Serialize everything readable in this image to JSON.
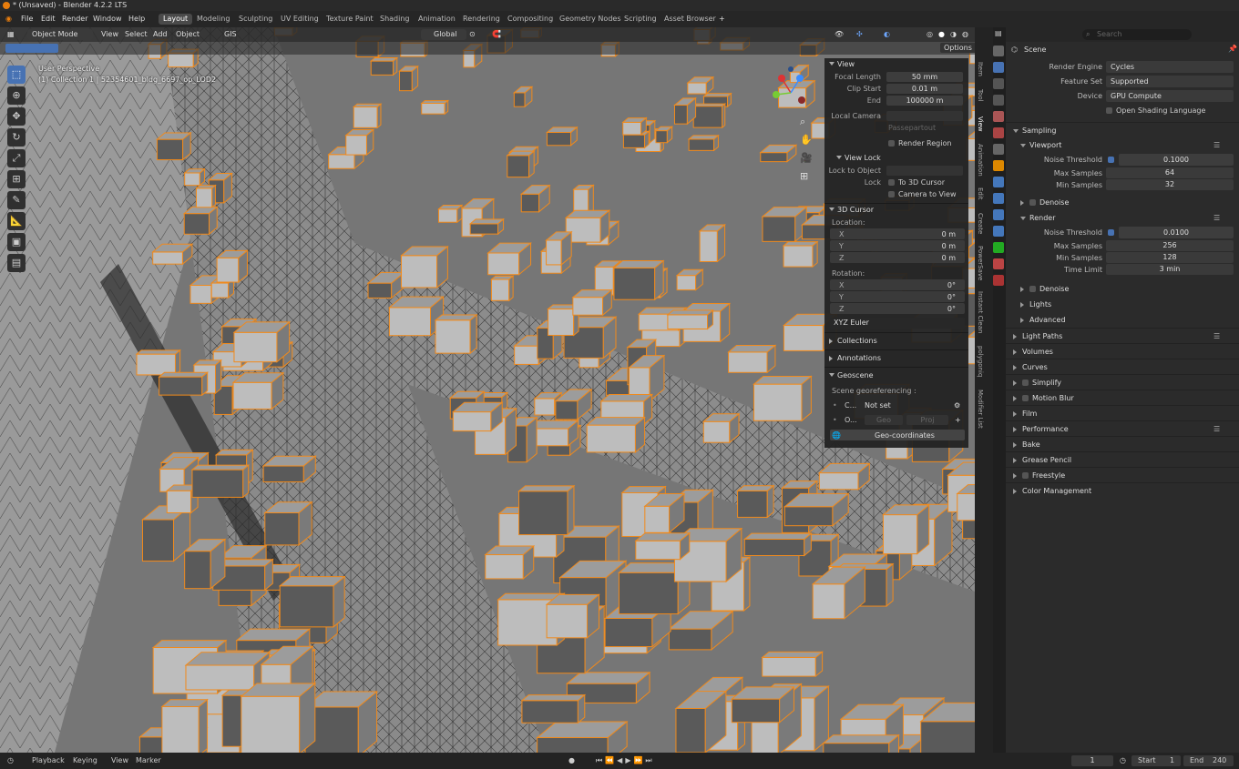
{
  "window": {
    "title": "* (Unsaved) - Blender 4.2.2 LTS"
  },
  "menu": {
    "file": "File",
    "edit": "Edit",
    "render": "Render",
    "window": "Window",
    "help": "Help"
  },
  "workspaces": [
    "Layout",
    "Modeling",
    "Sculpting",
    "UV Editing",
    "Texture Paint",
    "Shading",
    "Animation",
    "Rendering",
    "Compositing",
    "Geometry Nodes",
    "Scripting",
    "Asset Browser"
  ],
  "viewport": {
    "mode": "Object Mode",
    "menus": {
      "view": "View",
      "select": "Select",
      "add": "Add",
      "object": "Object",
      "gis": "GIS"
    },
    "orientation": "Global",
    "options": "Options",
    "info_line1": "User Perspective",
    "info_line2": "(1) Collection 1 | 52354601_bldg_6697_op_LOD2"
  },
  "npanel": {
    "view_header": "View",
    "focal_length_label": "Focal Length",
    "focal_length": "50 mm",
    "clip_start_label": "Clip Start",
    "clip_start": "0.01 m",
    "end_label": "End",
    "end": "100000 m",
    "local_camera_label": "Local Camera",
    "passepartout": "Passepartout",
    "render_region": "Render Region",
    "view_lock_header": "View Lock",
    "lock_to_object_label": "Lock to Object",
    "lock_label": "Lock",
    "to_3d_cursor": "To 3D Cursor",
    "camera_to_view": "Camera to View",
    "cursor_header": "3D Cursor",
    "location_label": "Location:",
    "rotation_label": "Rotation:",
    "x": "X",
    "y": "Y",
    "z": "Z",
    "loc_x": "0 m",
    "loc_y": "0 m",
    "loc_z": "0 m",
    "rot_x": "0°",
    "rot_y": "0°",
    "rot_z": "0°",
    "rotation_mode": "XYZ Euler",
    "collections": "Collections",
    "annotations": "Annotations",
    "geoscene": "Geoscene",
    "georef_label": "Scene georeferencing :",
    "crs_short": "C...",
    "crs_value": "Not set",
    "origin_short": "O...",
    "geo_btn": "Geo",
    "proj_btn": "Proj",
    "geo_coords_btn": "Geo-coordinates"
  },
  "side_tabs": [
    "Item",
    "Tool",
    "View",
    "Animation",
    "Edit",
    "Create",
    "PowerSave",
    "Instant Clean",
    "polygoniq",
    "Modifier List"
  ],
  "props": {
    "search_placeholder": "Search",
    "scene": "Scene",
    "render_engine_label": "Render Engine",
    "render_engine": "Cycles",
    "feature_set_label": "Feature Set",
    "feature_set": "Supported",
    "device_label": "Device",
    "device": "GPU Compute",
    "osl": "Open Shading Language",
    "sampling": "Sampling",
    "viewport": "Viewport",
    "noise_threshold_label": "Noise Threshold",
    "vp_noise": "0.1000",
    "max_samples_label": "Max Samples",
    "vp_max": "64",
    "min_samples_label": "Min Samples",
    "vp_min": "32",
    "denoise": "Denoise",
    "render": "Render",
    "r_noise": "0.0100",
    "r_max": "256",
    "r_min": "128",
    "time_limit_label": "Time Limit",
    "r_time": "3 min",
    "lights": "Lights",
    "advanced": "Advanced",
    "sections": [
      "Light Paths",
      "Volumes",
      "Curves",
      "Simplify",
      "Motion Blur",
      "Film",
      "Performance",
      "Bake",
      "Grease Pencil",
      "Freestyle",
      "Color Management"
    ]
  },
  "status": {
    "playback": "Playback",
    "keying": "Keying",
    "view": "View",
    "marker": "Marker",
    "frame": "1",
    "start_label": "Start",
    "start": "1",
    "end_label": "End",
    "end": "240"
  }
}
